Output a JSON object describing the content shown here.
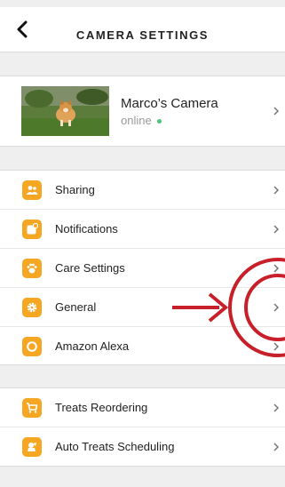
{
  "header": {
    "title": "CAMERA SETTINGS"
  },
  "camera": {
    "name": "Marco’s Camera",
    "status": "online"
  },
  "menu_group_1": [
    {
      "label": "Sharing",
      "icon": "people-icon"
    },
    {
      "label": "Notifications",
      "icon": "notification-icon"
    },
    {
      "label": "Care Settings",
      "icon": "paw-icon"
    },
    {
      "label": "General",
      "icon": "gear-icon"
    },
    {
      "label": "Amazon Alexa",
      "icon": "alexa-icon"
    }
  ],
  "menu_group_2": [
    {
      "label": "Treats Reordering",
      "icon": "cart-icon"
    },
    {
      "label": "Auto Treats Scheduling",
      "icon": "dog-icon"
    }
  ],
  "colors": {
    "accent": "#f5a623",
    "status_online": "#4cc27a",
    "annotation": "#c8202a"
  }
}
